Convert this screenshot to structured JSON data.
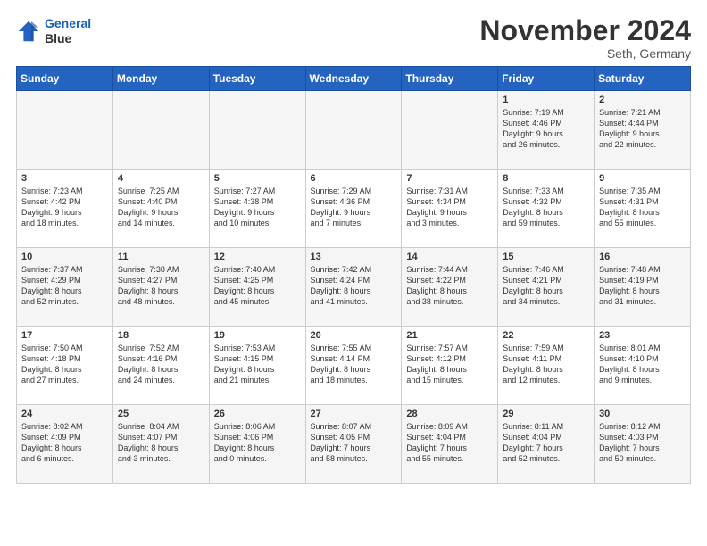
{
  "logo": {
    "line1": "General",
    "line2": "Blue"
  },
  "title": "November 2024",
  "location": "Seth, Germany",
  "days_of_week": [
    "Sunday",
    "Monday",
    "Tuesday",
    "Wednesday",
    "Thursday",
    "Friday",
    "Saturday"
  ],
  "weeks": [
    [
      {
        "day": "",
        "info": ""
      },
      {
        "day": "",
        "info": ""
      },
      {
        "day": "",
        "info": ""
      },
      {
        "day": "",
        "info": ""
      },
      {
        "day": "",
        "info": ""
      },
      {
        "day": "1",
        "info": "Sunrise: 7:19 AM\nSunset: 4:46 PM\nDaylight: 9 hours\nand 26 minutes."
      },
      {
        "day": "2",
        "info": "Sunrise: 7:21 AM\nSunset: 4:44 PM\nDaylight: 9 hours\nand 22 minutes."
      }
    ],
    [
      {
        "day": "3",
        "info": "Sunrise: 7:23 AM\nSunset: 4:42 PM\nDaylight: 9 hours\nand 18 minutes."
      },
      {
        "day": "4",
        "info": "Sunrise: 7:25 AM\nSunset: 4:40 PM\nDaylight: 9 hours\nand 14 minutes."
      },
      {
        "day": "5",
        "info": "Sunrise: 7:27 AM\nSunset: 4:38 PM\nDaylight: 9 hours\nand 10 minutes."
      },
      {
        "day": "6",
        "info": "Sunrise: 7:29 AM\nSunset: 4:36 PM\nDaylight: 9 hours\nand 7 minutes."
      },
      {
        "day": "7",
        "info": "Sunrise: 7:31 AM\nSunset: 4:34 PM\nDaylight: 9 hours\nand 3 minutes."
      },
      {
        "day": "8",
        "info": "Sunrise: 7:33 AM\nSunset: 4:32 PM\nDaylight: 8 hours\nand 59 minutes."
      },
      {
        "day": "9",
        "info": "Sunrise: 7:35 AM\nSunset: 4:31 PM\nDaylight: 8 hours\nand 55 minutes."
      }
    ],
    [
      {
        "day": "10",
        "info": "Sunrise: 7:37 AM\nSunset: 4:29 PM\nDaylight: 8 hours\nand 52 minutes."
      },
      {
        "day": "11",
        "info": "Sunrise: 7:38 AM\nSunset: 4:27 PM\nDaylight: 8 hours\nand 48 minutes."
      },
      {
        "day": "12",
        "info": "Sunrise: 7:40 AM\nSunset: 4:25 PM\nDaylight: 8 hours\nand 45 minutes."
      },
      {
        "day": "13",
        "info": "Sunrise: 7:42 AM\nSunset: 4:24 PM\nDaylight: 8 hours\nand 41 minutes."
      },
      {
        "day": "14",
        "info": "Sunrise: 7:44 AM\nSunset: 4:22 PM\nDaylight: 8 hours\nand 38 minutes."
      },
      {
        "day": "15",
        "info": "Sunrise: 7:46 AM\nSunset: 4:21 PM\nDaylight: 8 hours\nand 34 minutes."
      },
      {
        "day": "16",
        "info": "Sunrise: 7:48 AM\nSunset: 4:19 PM\nDaylight: 8 hours\nand 31 minutes."
      }
    ],
    [
      {
        "day": "17",
        "info": "Sunrise: 7:50 AM\nSunset: 4:18 PM\nDaylight: 8 hours\nand 27 minutes."
      },
      {
        "day": "18",
        "info": "Sunrise: 7:52 AM\nSunset: 4:16 PM\nDaylight: 8 hours\nand 24 minutes."
      },
      {
        "day": "19",
        "info": "Sunrise: 7:53 AM\nSunset: 4:15 PM\nDaylight: 8 hours\nand 21 minutes."
      },
      {
        "day": "20",
        "info": "Sunrise: 7:55 AM\nSunset: 4:14 PM\nDaylight: 8 hours\nand 18 minutes."
      },
      {
        "day": "21",
        "info": "Sunrise: 7:57 AM\nSunset: 4:12 PM\nDaylight: 8 hours\nand 15 minutes."
      },
      {
        "day": "22",
        "info": "Sunrise: 7:59 AM\nSunset: 4:11 PM\nDaylight: 8 hours\nand 12 minutes."
      },
      {
        "day": "23",
        "info": "Sunrise: 8:01 AM\nSunset: 4:10 PM\nDaylight: 8 hours\nand 9 minutes."
      }
    ],
    [
      {
        "day": "24",
        "info": "Sunrise: 8:02 AM\nSunset: 4:09 PM\nDaylight: 8 hours\nand 6 minutes."
      },
      {
        "day": "25",
        "info": "Sunrise: 8:04 AM\nSunset: 4:07 PM\nDaylight: 8 hours\nand 3 minutes."
      },
      {
        "day": "26",
        "info": "Sunrise: 8:06 AM\nSunset: 4:06 PM\nDaylight: 8 hours\nand 0 minutes."
      },
      {
        "day": "27",
        "info": "Sunrise: 8:07 AM\nSunset: 4:05 PM\nDaylight: 7 hours\nand 58 minutes."
      },
      {
        "day": "28",
        "info": "Sunrise: 8:09 AM\nSunset: 4:04 PM\nDaylight: 7 hours\nand 55 minutes."
      },
      {
        "day": "29",
        "info": "Sunrise: 8:11 AM\nSunset: 4:04 PM\nDaylight: 7 hours\nand 52 minutes."
      },
      {
        "day": "30",
        "info": "Sunrise: 8:12 AM\nSunset: 4:03 PM\nDaylight: 7 hours\nand 50 minutes."
      }
    ]
  ]
}
